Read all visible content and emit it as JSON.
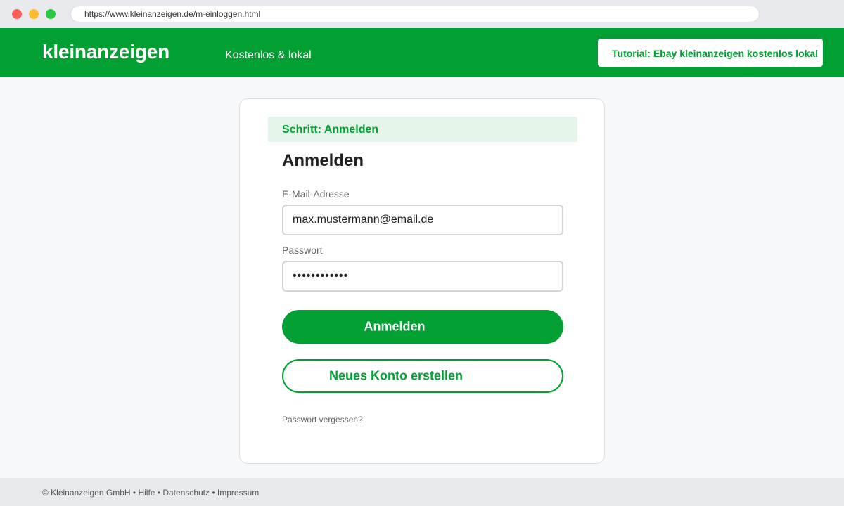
{
  "browser": {
    "url": "https://www.kleinanzeigen.de/m-einloggen.html"
  },
  "header": {
    "logo": "kleinanzeigen",
    "tagline": "Kostenlos & lokal",
    "tutorial_label": "Tutorial: Ebay kleinanzeigen kostenlos lokal"
  },
  "login": {
    "step_label": "Schritt: Anmelden",
    "title": "Anmelden",
    "email_label": "E-Mail-Adresse",
    "email_value": "max.mustermann@email.de",
    "password_label": "Passwort",
    "password_value": "••••••••••••",
    "submit_label": "Anmelden",
    "register_label": "Neues Konto erstellen",
    "forgot_label": "Passwort vergessen?"
  },
  "footer": {
    "text": "© Kleinanzeigen GmbH • Hilfe • Datenschutz • Impressum"
  },
  "colors": {
    "brand_green": "#02a033",
    "banner_bg": "#e6f5ea"
  }
}
